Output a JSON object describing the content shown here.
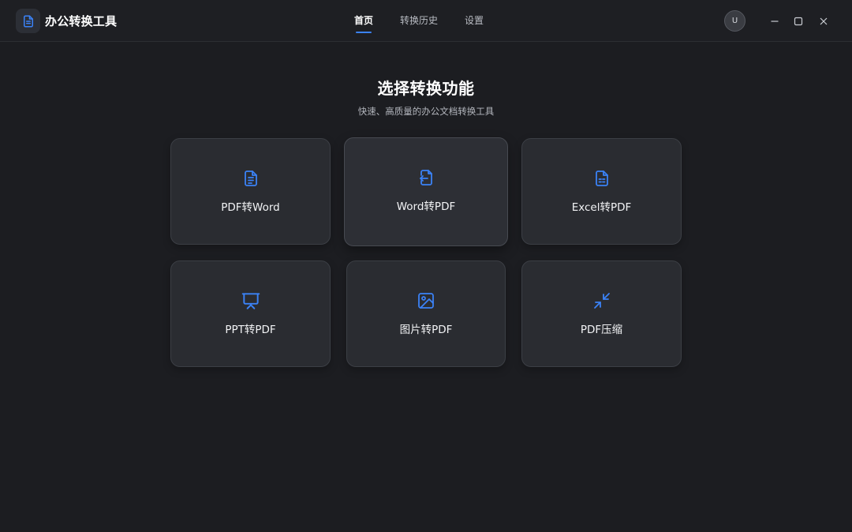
{
  "app": {
    "title": "办公转换工具",
    "logo_icon": "document-icon"
  },
  "nav": {
    "tabs": [
      {
        "label": "首页",
        "active": true
      },
      {
        "label": "转换历史",
        "active": false
      },
      {
        "label": "设置",
        "active": false
      }
    ]
  },
  "user": {
    "avatar_initial": "U"
  },
  "window_controls": {
    "minimize_icon": "minimize-icon",
    "maximize_icon": "maximize-icon",
    "close_icon": "close-icon"
  },
  "main": {
    "heading": "选择转换功能",
    "subheading": "快速、高质量的办公文档转换工具",
    "cards": [
      {
        "label": "PDF转Word",
        "icon": "document-text-icon"
      },
      {
        "label": "Word转PDF",
        "icon": "document-import-icon"
      },
      {
        "label": "Excel转PDF",
        "icon": "spreadsheet-icon"
      },
      {
        "label": "PPT转PDF",
        "icon": "presentation-icon"
      },
      {
        "label": "图片转PDF",
        "icon": "image-icon"
      },
      {
        "label": "PDF压缩",
        "icon": "compress-icon"
      }
    ]
  },
  "colors": {
    "accent": "#3b82f6",
    "background": "#1c1d21",
    "card": "#2a2c31"
  }
}
